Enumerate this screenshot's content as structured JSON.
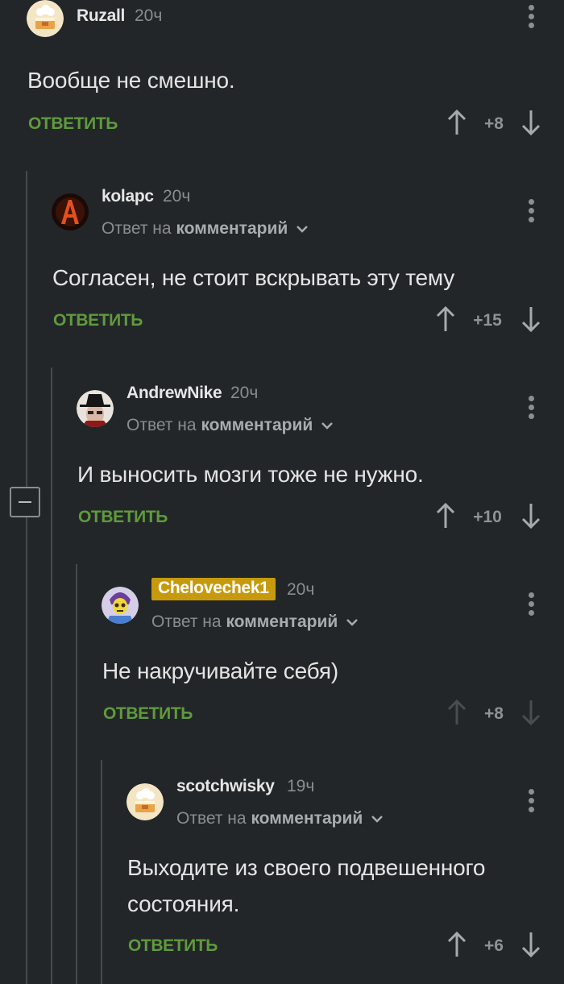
{
  "comments": [
    {
      "author": "Ruzall",
      "time": "20ч",
      "reply_to": "",
      "text": "Вообще не смешно.",
      "reply_label": "ОТВЕТИТЬ",
      "score": "+8",
      "avatar": "cake-avatar"
    },
    {
      "author": "kolapc",
      "time": "20ч",
      "reply_to_prefix": "Ответ на",
      "reply_to": "комментарий",
      "text": "Согласен, не стоит вскрывать эту тему",
      "reply_label": "ОТВЕТИТЬ",
      "score": "+15",
      "avatar": "fire-letter-a-avatar"
    },
    {
      "author": "AndrewNike",
      "time": "20ч",
      "reply_to_prefix": "Ответ на",
      "reply_to": "комментарий",
      "text": "И выносить мозги тоже не нужно.",
      "reply_label": "ОТВЕТИТЬ",
      "score": "+10",
      "avatar": "hat-man-avatar"
    },
    {
      "author": "Chelovechek1",
      "time": "20ч",
      "reply_to_prefix": "Ответ на",
      "reply_to": "комментарий",
      "text": "Не накручивайте себя)",
      "reply_label": "ОТВЕТИТЬ",
      "score": "+8",
      "avatar": "skeletor-avatar",
      "badge_color": "#c79a0e"
    },
    {
      "author": "scotchwisky",
      "time": "19ч",
      "reply_to_prefix": "Ответ на",
      "reply_to": "комментарий",
      "text": "Выходите из своего подвешенного состояния.",
      "reply_label": "ОТВЕТИТЬ",
      "score": "+6",
      "avatar": "cake-avatar"
    }
  ],
  "colors": {
    "background": "#232628",
    "reply_green": "#5f9a3c",
    "thread_line": "#474a4d",
    "badge": "#c79a0e"
  }
}
